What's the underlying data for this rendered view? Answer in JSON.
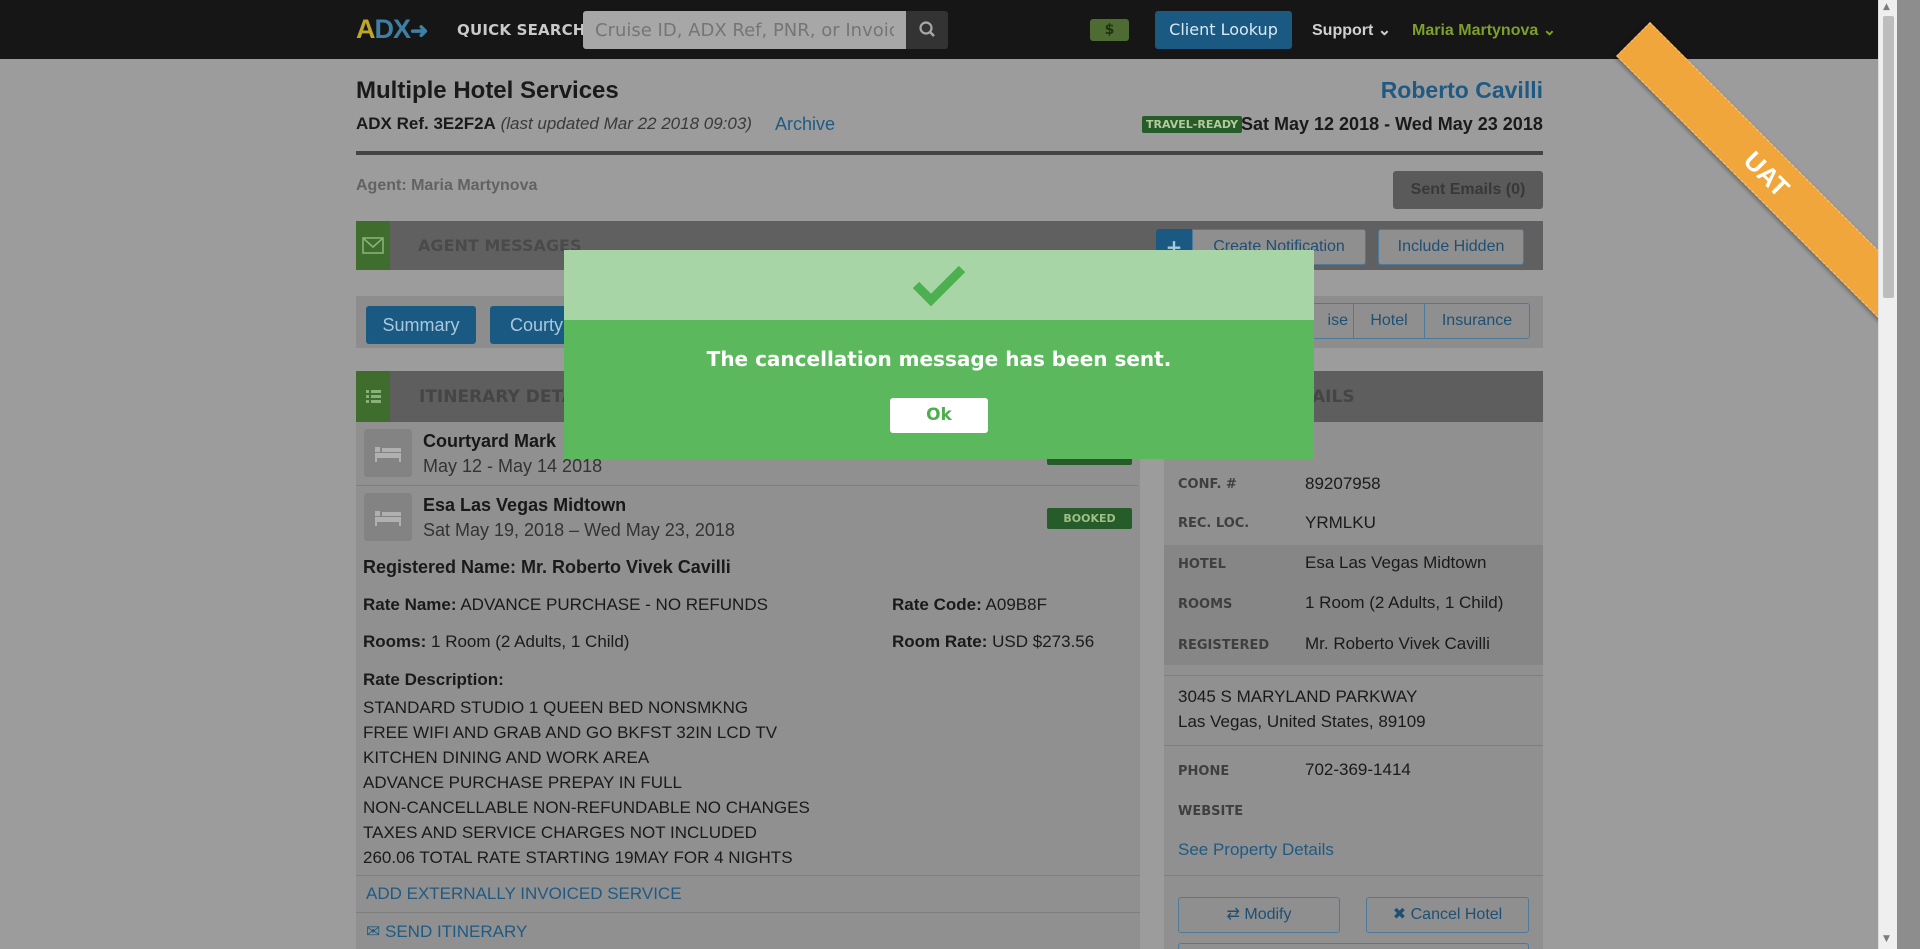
{
  "nav": {
    "logo_a": "A",
    "logo_dx": "DX",
    "logo_arrow": "➜",
    "quick_search_label": "QUICK SEARCH",
    "search_placeholder": "Cruise ID, ADX Ref, PNR, or Invoice #.",
    "dollar_label": "$",
    "client_lookup": "Client Lookup",
    "support": "Support",
    "user": "Maria Martynova"
  },
  "ribbon": "UAT",
  "header": {
    "title": "Multiple Hotel Services",
    "ref_label": "ADX Ref. 3E2F2A",
    "last_updated": "(last updated Mar 22 2018 09:03)",
    "archive": "Archive",
    "client_name": "Roberto Cavilli",
    "status_badge": "TRAVEL-READY",
    "date_range": "Sat May 12 2018 - Wed May 23 2018"
  },
  "agent": {
    "label": "Agent: Maria Martynova",
    "sent_emails": "Sent Emails (0)"
  },
  "messages": {
    "title": "AGENT MESSAGES",
    "plus": "+",
    "create_notification": "Create Notification",
    "include_hidden": "Include Hidden"
  },
  "tabs": {
    "summary": "Summary",
    "courtyard": "Courty",
    "cruise": "ise",
    "hotel": "Hotel",
    "insurance": "Insurance"
  },
  "itinerary": {
    "title": "ITINERARY DETA",
    "hotels": [
      {
        "name": "Courtyard Mark",
        "dates": "May 12 - May 14 2018"
      },
      {
        "name": "Esa Las Vegas Midtown",
        "dates": "Sat May 19, 2018 – Wed May 23, 2018",
        "status": "BOOKED"
      }
    ],
    "registered_name": "Registered Name: Mr. Roberto Vivek Cavilli",
    "rate_name_label": "Rate Name:",
    "rate_name_value": "ADVANCE PURCHASE - NO REFUNDS",
    "rate_code_label": "Rate Code:",
    "rate_code_value": "A09B8F",
    "rooms_label": "Rooms:",
    "rooms_value": "1 Room (2 Adults, 1 Child)",
    "room_rate_label": "Room Rate:",
    "room_rate_value": "USD $273.56",
    "rate_desc_label": "Rate Description:",
    "rate_desc_lines": [
      "STANDARD STUDIO 1 QUEEN BED NONSMKNG",
      "FREE WIFI AND GRAB AND GO BKFST 32IN LCD TV",
      "KITCHEN DINING AND WORK AREA",
      "ADVANCE PURCHASE PREPAY IN FULL",
      "NON-CANCELLABLE NON-REFUNDABLE NO CHANGES",
      "TAXES AND SERVICE CHARGES NOT INCLUDED",
      "260.06 TOTAL RATE STARTING 19MAY FOR 4 NIGHTS"
    ],
    "add_external": "ADD EXTERNALLY INVOICED SERVICE",
    "send_itinerary": "SEND ITINERARY"
  },
  "details": {
    "title": "AILS",
    "conf_label": "CONF. #",
    "conf_value": "89207958",
    "recloc_label": "REC. LOC.",
    "recloc_value": "YRMLKU",
    "hotel_label": "HOTEL",
    "hotel_value": "Esa Las Vegas Midtown",
    "rooms_label": "ROOMS",
    "rooms_value": "1 Room (2 Adults, 1 Child)",
    "registered_label": "REGISTERED",
    "registered_value": "Mr. Roberto Vivek Cavilli",
    "address_line1": "3045 S MARYLAND PARKWAY",
    "address_line2": "Las Vegas, United States, 89109",
    "phone_label": "PHONE",
    "phone_value": "702-369-1414",
    "website_label": "WEBSITE",
    "see_property": "See Property Details",
    "modify": "Modify",
    "cancel_hotel": "Cancel Hotel"
  },
  "modal": {
    "message": "The cancellation message has been sent.",
    "ok": "Ok"
  },
  "colors": {
    "success": "#5cb85c",
    "primary": "#1a5a82",
    "ribbon": "#f0a63a"
  }
}
